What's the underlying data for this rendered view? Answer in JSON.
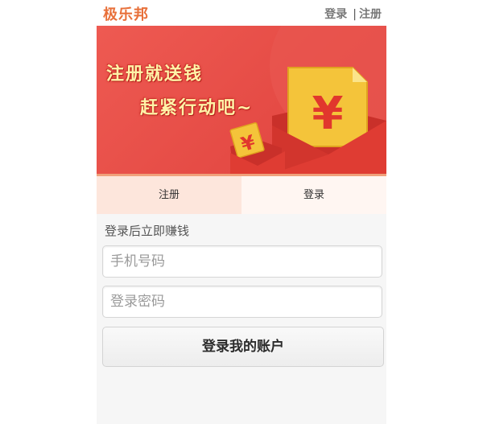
{
  "header": {
    "brand": "极乐邦",
    "login_link": "登录",
    "separator": "|",
    "register_link": "注册"
  },
  "banner": {
    "line1": "注册就送钱",
    "line2": "赶紧行动吧~",
    "big_symbol": "¥",
    "small_symbol": "¥",
    "colors": {
      "background": "#e54b45",
      "envelope": "#d9342c",
      "coin": "#f7d33a",
      "text": "#fff3a8"
    }
  },
  "tabs": {
    "register_label": "注册",
    "login_label": "登录"
  },
  "form": {
    "hint": "登录后立即赚钱",
    "phone_placeholder": "手机号码",
    "password_placeholder": "登录密码",
    "submit_label": "登录我的账户"
  }
}
